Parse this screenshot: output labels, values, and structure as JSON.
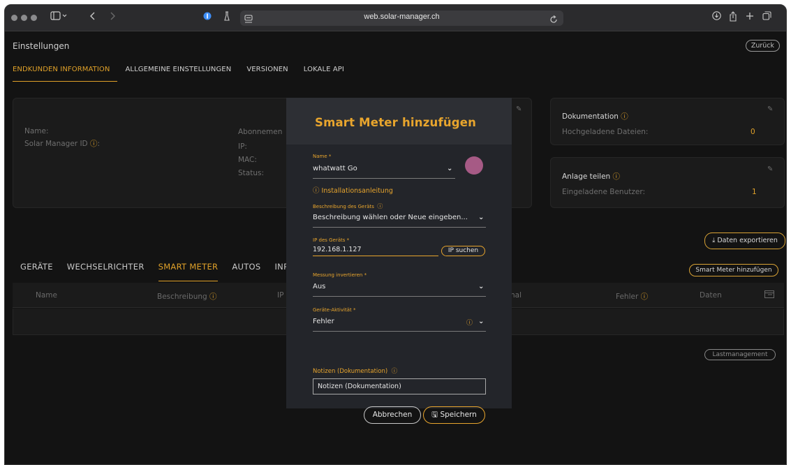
{
  "browser": {
    "url": "web.solar-manager.ch"
  },
  "page": {
    "title": "Einstellungen",
    "back_label": "Zurück"
  },
  "top_tabs": [
    {
      "label": "ENDKUNDEN INFORMATION",
      "active": true
    },
    {
      "label": "ALLGEMEINE EINSTELLUNGEN",
      "active": false
    },
    {
      "label": "VERSIONEN",
      "active": false
    },
    {
      "label": "LOKALE API",
      "active": false
    }
  ],
  "customer_card": {
    "name_label": "Name:",
    "id_label": "Solar Manager ID",
    "id_suffix": ":",
    "subscription_label": "Abonnemen",
    "ip_label": "IP:",
    "mac_label": "MAC:",
    "status_label": "Status:"
  },
  "docs_card": {
    "heading": "Dokumentation",
    "uploaded_label": "Hochgeladene Dateien:",
    "uploaded_count": "0"
  },
  "share_card": {
    "heading": "Anlage teilen",
    "invited_label": "Eingeladene Benutzer:",
    "invited_count": "1"
  },
  "export_button": "Daten exportieren",
  "sub_tabs": [
    {
      "label": "GERÄTE",
      "active": false
    },
    {
      "label": "WECHSELRICHTER",
      "active": false
    },
    {
      "label": "SMART METER",
      "active": true
    },
    {
      "label": "AUTOS",
      "active": false
    },
    {
      "label": "INPU",
      "active": false
    }
  ],
  "add_smart_meter_button": "Smart Meter hinzufügen",
  "table": {
    "col_name": "Name",
    "col_description": "Beschreibung",
    "col_ip": "IP",
    "col_signal": "nal",
    "col_error": "Fehler",
    "col_data": "Daten"
  },
  "load_management_button": "Lastmanagement",
  "modal": {
    "title": "Smart Meter hinzufügen",
    "name_label": "Name *",
    "name_value": "whatwatt Go",
    "install_guide": "Installationsanleitung",
    "description_label": "Beschreibung des Geräts",
    "description_value": "Beschreibung wählen oder Neue eingeben...",
    "ip_label": "IP des Geräts *",
    "ip_value": "192.168.1.127",
    "ip_search": "IP suchen",
    "invert_label": "Messung invertieren *",
    "invert_value": "Aus",
    "activity_label": "Geräte-Aktivität *",
    "activity_value": "Fehler",
    "notes_label": "Notizen (Dokumentation)",
    "notes_value": "Notizen (Dokumentation)",
    "cancel": "Abbrechen",
    "save": "Speichern"
  },
  "colors": {
    "accent": "#e0a129",
    "background": "#131313",
    "card": "#1b1b1b",
    "modal": "#23252a",
    "avatar": "#a65a85"
  }
}
